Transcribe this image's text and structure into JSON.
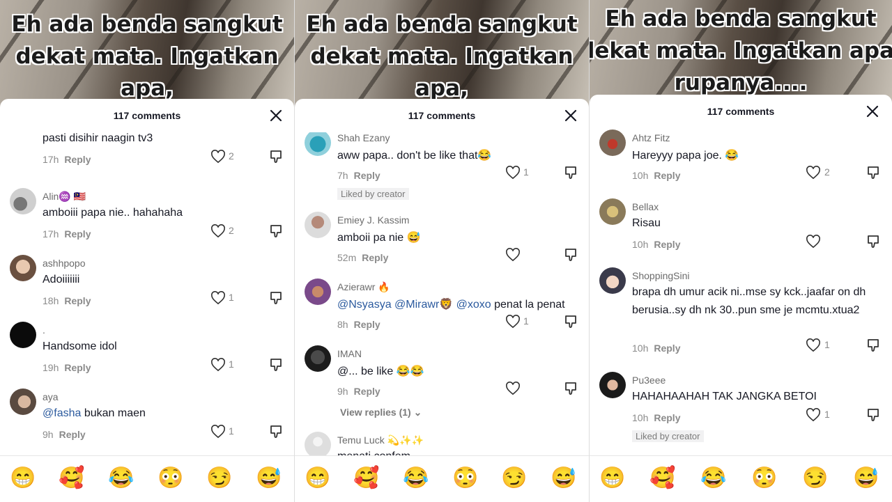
{
  "video_caption": "Eh ada benda sangkut\ndekat mata. Ingatkan apa,\nrupanya....",
  "comment_count": "117 comments",
  "reply_label": "Reply",
  "liked_by_creator": "Liked by creator",
  "emojis": [
    "😁",
    "🥰",
    "😂",
    "😳",
    "😏",
    "😅"
  ],
  "panels": [
    {
      "comments": [
        {
          "name": "",
          "text": "pasti disihir naagin tv3",
          "time": "17h",
          "likes": "2"
        },
        {
          "name": "Alin♒ 🇲🇾",
          "text": "amboiii papa nie.. hahahaha",
          "time": "17h",
          "likes": "2"
        },
        {
          "name": "ashhpopo",
          "text": "Adoiiiiiii",
          "time": "18h",
          "likes": "1"
        },
        {
          "name": ".",
          "text": "Handsome idol",
          "time": "19h",
          "likes": "1"
        },
        {
          "name": "aya",
          "mention": "@fasha",
          "text": " bukan maen",
          "time": "9h",
          "likes": "1"
        }
      ]
    },
    {
      "comments": [
        {
          "name": "Shah Ezany",
          "text": "aww papa.. don't be like that😂",
          "time": "7h",
          "likes": "1"
        },
        {
          "name": "Emiey J. Kassim",
          "text": "amboii pa nie 😅",
          "time": "52m",
          "likes": ""
        },
        {
          "name": "Azierawr 🔥",
          "mention": "@Nsyasya @Mirawr🦁 @xoxo",
          "text": " penat la penat",
          "time": "8h",
          "likes": "1"
        },
        {
          "name": "IMAN",
          "text": "@... be like 😂😂",
          "time": "9h",
          "likes": ""
        },
        {
          "name": "Temu Luck 💫✨✨",
          "text": "menati confem",
          "time": "",
          "likes": ""
        }
      ],
      "view_replies": "View replies (1)"
    },
    {
      "comments": [
        {
          "name": "Ahtz Fitz",
          "text": "Hareyyy papa joe. 😂",
          "time": "10h",
          "likes": "2"
        },
        {
          "name": "Bellax",
          "text": "Risau",
          "time": "10h",
          "likes": ""
        },
        {
          "name": "ShoppingSini",
          "text": "brapa dh umur acik ni..mse sy kck..jaafar on dh berusia..sy dh nk 30..pun sme je mcmtu.xtua2",
          "time": "10h",
          "likes": "1"
        },
        {
          "name": "Pu3eee",
          "text": "HAHAHAAHAH TAK JANGKA BETOI",
          "time": "10h",
          "likes": "1"
        }
      ]
    }
  ],
  "colors": {
    "mention": "#2b5a9e",
    "text": "#161823",
    "muted": "#8a8a8a"
  }
}
